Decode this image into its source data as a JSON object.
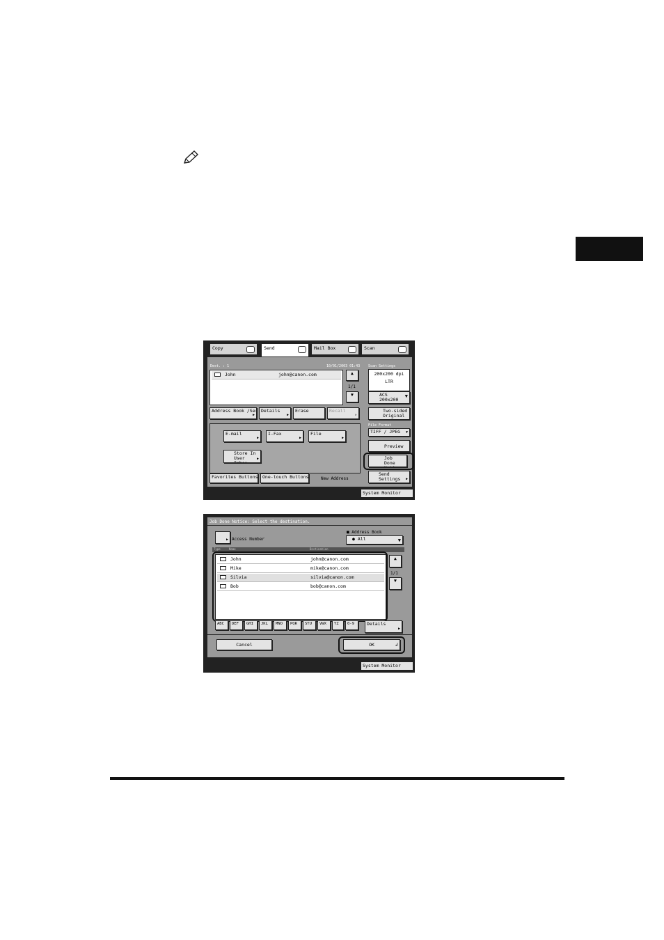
{
  "screen1": {
    "tabs": [
      "Copy",
      "Send",
      "Mail Box",
      "Scan"
    ],
    "doc_label": "Dest. :",
    "doc_count": "1",
    "datetime": "10/01/2003 01:43",
    "destinations": [
      {
        "name": "John",
        "address": "john@canon.com"
      }
    ],
    "page": "1/1",
    "buttons": {
      "address_book": "Address Book /Server",
      "details": "Details",
      "erase": "Erase",
      "recall": "Recall",
      "email": "E-mail",
      "ifax": "I-Fax",
      "file": "File",
      "store_inbox": "Store In User Inbox",
      "favorites": "Favorites Buttons",
      "one_touch": "One-touch Buttons",
      "new_address": "New Address"
    },
    "scan_settings": {
      "title": "Scan Settings",
      "resolution": "200x200 dpi",
      "size": "LTR",
      "mode": "ACS 200x200"
    },
    "two_sided": "Two-sided Original",
    "file_format": {
      "title": "File Format",
      "value": "TIFF / JPEG"
    },
    "preview": "Preview",
    "job_done": "Job Done Notice",
    "send_settings": "Send Settings",
    "system_monitor": "System Monitor"
  },
  "screen2": {
    "title": "Job Done Notice: Select the destination.",
    "access_number": "Access Number",
    "address_book_label": "Address Book",
    "address_book_value": "All",
    "columns": [
      "Type",
      "Name",
      "Destination"
    ],
    "rows": [
      {
        "name": "John",
        "address": "john@canon.com"
      },
      {
        "name": "Mike",
        "address": "mike@canon.com"
      },
      {
        "name": "Silvia",
        "address": "silvia@canon.com"
      },
      {
        "name": "Bob",
        "address": "bob@canon.com"
      }
    ],
    "page": "1/1",
    "index_keys": [
      "ABC",
      "DEF",
      "GHI",
      "JKL",
      "MNO",
      "PQR",
      "STU",
      "VWX",
      "YZ",
      "0-9"
    ],
    "details": "Details",
    "cancel": "Cancel",
    "ok": "OK",
    "system_monitor": "System Monitor"
  }
}
